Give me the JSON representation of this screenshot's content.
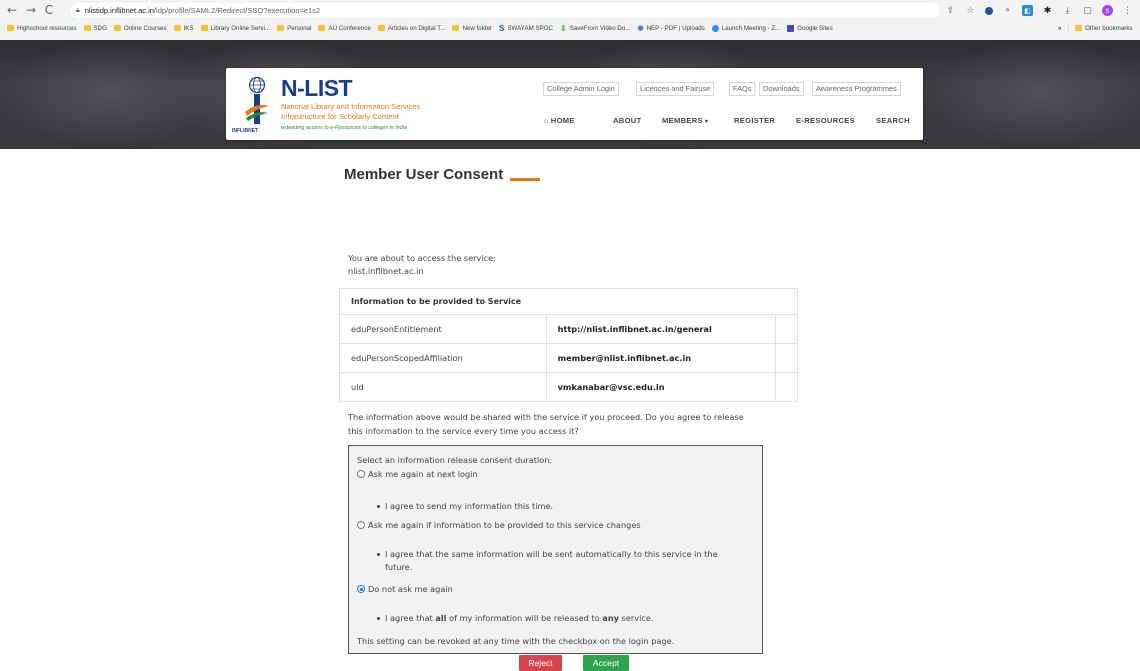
{
  "browser": {
    "url_host": "nlistidp.inflibnet.ac.in",
    "url_path": "/idp/profile/SAML2/Redirect/SSO?execution=e1s2",
    "profile_initial": "S",
    "bookmarks": [
      {
        "label": "Highschool resources",
        "icon": "folder-icon",
        "color": "#f9c232"
      },
      {
        "label": "SDG",
        "icon": "folder-icon",
        "color": "#f9c232"
      },
      {
        "label": "Online Courses",
        "icon": "folder-icon",
        "color": "#f9c232"
      },
      {
        "label": "IKS",
        "icon": "folder-icon",
        "color": "#f9c232"
      },
      {
        "label": "Library Online Servi...",
        "icon": "folder-icon",
        "color": "#f9c232"
      },
      {
        "label": "Personal",
        "icon": "folder-icon",
        "color": "#f9c232"
      },
      {
        "label": "AU Conference",
        "icon": "folder-icon",
        "color": "#f9c232"
      },
      {
        "label": "Articles on Digital T...",
        "icon": "folder-icon",
        "color": "#f9c232"
      },
      {
        "label": "New folder",
        "icon": "folder-icon",
        "color": "#f9c232"
      },
      {
        "label": "SWAYAM SPOC",
        "icon": "swayam-icon",
        "color": "#1e5bb8"
      },
      {
        "label": "SaveFrom Video Do...",
        "icon": "savefrom-icon",
        "color": "#6dbf3a"
      },
      {
        "label": "NEP - PDF | Uploads",
        "icon": "nep-icon",
        "color": "#3a78c9"
      },
      {
        "label": "Launch Meeting - Z...",
        "icon": "zoom-icon",
        "color": "#2d8cff"
      },
      {
        "label": "Google Sites",
        "icon": "google-sites-icon",
        "color": "#3f51b5"
      }
    ],
    "bookmarks_overflow": "»",
    "other_bookmarks": "Other bookmarks"
  },
  "site": {
    "logo_title": "N-LIST",
    "logo_subtitle_1": "National Library and Information Services",
    "logo_subtitle_2": "Infrastructure for Scholarly Content",
    "logo_tagline": "extending access to e-Resources to colleges in India",
    "logo_org": "INFLIBNET",
    "top_links": [
      "College Admin Login",
      "Licences and Fairuse",
      "FAQs",
      "Downloads",
      "Awareness Programmes"
    ],
    "nav": {
      "home": "HOME",
      "about": "ABOUT",
      "members": "MEMBERS",
      "register": "REGISTER",
      "eresources": "E-RESOURCES",
      "search": "SEARCH"
    }
  },
  "consent": {
    "title": "Member User Consent",
    "intro": "You are about to access the service:",
    "service": "nlist.inflibnet.ac.in",
    "table_header": "Information to be provided to Service",
    "rows": [
      {
        "attr": "eduPersonEntitlement",
        "value": "http://nlist.inflibnet.ac.in/general"
      },
      {
        "attr": "eduPersonScopedAffiliation",
        "value": "member@nlist.inflibnet.ac.in"
      },
      {
        "attr": "uid",
        "value": "vmkanabar@vsc.edu.in"
      }
    ],
    "question_line1": "The information above would be shared with the service if you proceed. Do you agree to release",
    "question_line2": "this information to the service every time you access it?",
    "duration_label": "Select an information release consent duration:",
    "options": [
      {
        "label": "Ask me again at next login",
        "detail": [
          "I agree to send my information this time."
        ],
        "selected": false
      },
      {
        "label": "Ask me again if information to be provided to this service changes",
        "detail": [
          "I agree that the same information will be sent automatically to this service in the",
          "future."
        ],
        "selected": false
      },
      {
        "label": "Do not ask me again",
        "detail_pre": "I agree that ",
        "detail_b1": "all",
        "detail_mid": " of my information will be released to ",
        "detail_b2": "any",
        "detail_post": " service.",
        "selected": true
      }
    ],
    "revoke_note": "This setting can be revoked at any time with the checkbox on the login page.",
    "reject": "Reject",
    "accept": "Accept"
  },
  "colors": {
    "brand_blue": "#1a3f8a",
    "brand_orange": "#e8781a",
    "reject_red": "#d9434e",
    "accept_green": "#2ea44f",
    "radio_blue": "#1a73e8"
  }
}
